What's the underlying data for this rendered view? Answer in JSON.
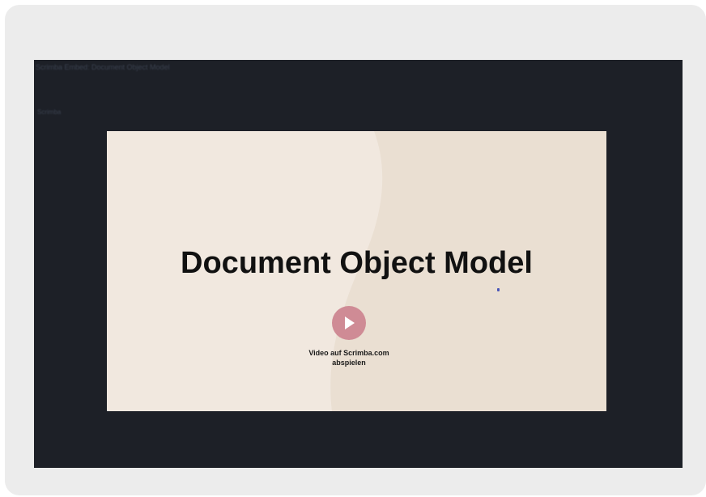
{
  "frame": {
    "title": "Scrimba Embed: Document Object Model",
    "subtitle": "Scrimba"
  },
  "slide": {
    "title": "Document Object Model",
    "play_caption_line1": "Video auf Scrimba.com",
    "play_caption_line2": "abspielen",
    "background_color": "#f1e8df",
    "accent_color": "#cf8b95"
  },
  "icons": {
    "play": "play-icon"
  }
}
